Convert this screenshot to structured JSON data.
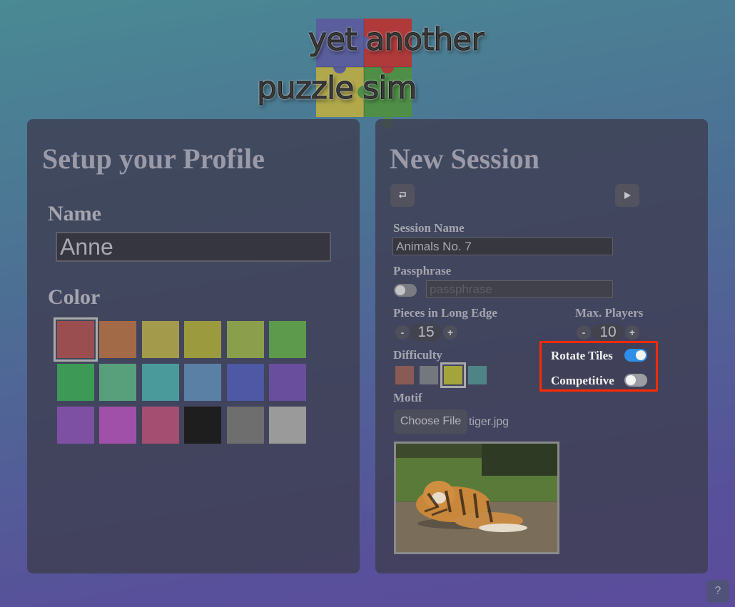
{
  "logo": {
    "line1": "yet another",
    "line2": "puzzle sim"
  },
  "profile": {
    "title": "Setup your Profile",
    "name_label": "Name",
    "name_value": "Anne",
    "color_label": "Color",
    "selected_index": 0,
    "colors": [
      "#9a4e50",
      "#a36a48",
      "#a49a4c",
      "#9c9a3e",
      "#8a9e4c",
      "#5e9a4c",
      "#3d9a56",
      "#58a07c",
      "#4a9a9c",
      "#5a80a6",
      "#4e58a4",
      "#6a4e9e",
      "#7e50a4",
      "#a050a8",
      "#a44e72",
      "#1e1e1e",
      "#6e6e6e",
      "#9a9a9a"
    ]
  },
  "session": {
    "title": "New Session",
    "back_icon": "return-arrow-icon",
    "play_icon": "play-icon",
    "session_name_label": "Session Name",
    "session_name_value": "Animals No. 7",
    "passphrase_label": "Passphrase",
    "passphrase_placeholder": "passphrase",
    "passphrase_enabled": false,
    "pieces_label": "Pieces in Long Edge",
    "pieces_value": "15",
    "max_players_label": "Max. Players",
    "max_players_value": "10",
    "minus": "-",
    "plus": "+",
    "difficulty_label": "Difficulty",
    "difficulty_colors": [
      "#8a5a54",
      "#74777e",
      "#a4a43c",
      "#4e8486"
    ],
    "difficulty_selected": 2,
    "rotate_label": "Rotate Tiles",
    "rotate_on": true,
    "competitive_label": "Competitive",
    "competitive_on": false,
    "motif_label": "Motif",
    "choose_file_label": "Choose File",
    "file_name": "tiger.jpg"
  },
  "help": {
    "label": "?"
  }
}
